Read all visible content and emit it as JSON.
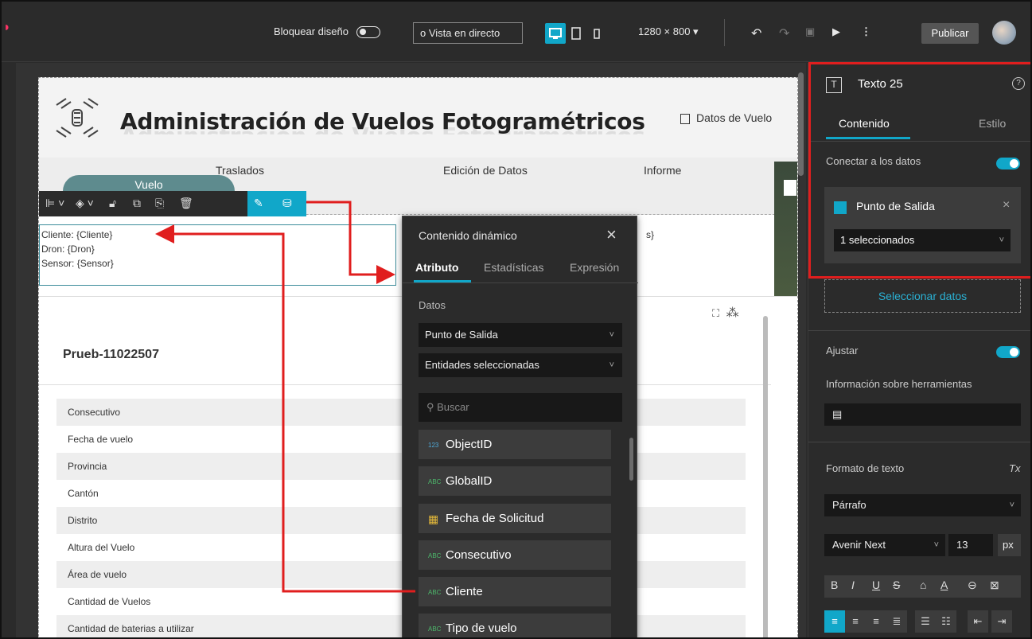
{
  "topbar": {
    "bloquear_label": "Bloquear diseño",
    "vista_label": "Vista en directo",
    "vista_icon": "circle-icon",
    "resolution": "1280 × 800",
    "publicar_label": "Publicar"
  },
  "page": {
    "title": "Administración de Vuelos Fotogramétricos",
    "title_shadow": "Administración de Vuelos Fotogramétricos",
    "datos_vuelo_link": "Datos de Vuelo",
    "nav": [
      "Vuelo",
      "Traslados",
      "Edición de Datos",
      "Informe"
    ]
  },
  "text_widget": {
    "lines": [
      "Cliente: {Cliente}",
      "Dron: {Dron}",
      "Sensor: {Sensor}"
    ],
    "partial_text": "s}"
  },
  "card": {
    "title": "Prueb-11022507",
    "rows": [
      "Consecutivo",
      "Fecha de vuelo",
      "Provincia",
      "Cantón",
      "Distrito",
      "Altura del Vuelo",
      "Área de vuelo",
      "Cantidad de Vuelos",
      "Cantidad de baterias a utilizar"
    ]
  },
  "popup": {
    "title": "Contenido dinámico",
    "tabs": [
      "Atributo",
      "Estadísticas",
      "Expresión"
    ],
    "datos_label": "Datos",
    "data_source": "Punto de Salida",
    "selection": "Entidades seleccionadas",
    "search_placeholder": "Buscar",
    "fields": [
      {
        "type": "123",
        "name": "ObjectID"
      },
      {
        "type": "ABC",
        "name": "GlobalID"
      },
      {
        "type": "date",
        "name": "Fecha de Solicitud"
      },
      {
        "type": "ABC",
        "name": "Consecutivo"
      },
      {
        "type": "ABC",
        "name": "Cliente"
      },
      {
        "type": "ABC",
        "name": "Tipo de vuelo"
      }
    ]
  },
  "rpanel": {
    "title": "Texto 25",
    "tabs": [
      "Contenido",
      "Estilo"
    ],
    "connect_label": "Conectar a los datos",
    "source_name": "Punto de Salida",
    "selection_value": "1 seleccionados",
    "select_data": "Seleccionar datos",
    "ajustar": "Ajustar",
    "tooltip_label": "Información sobre herramientas",
    "formato_label": "Formato de texto",
    "paragraph": "Párrafo",
    "font": "Avenir Next",
    "size": "13",
    "unit": "px"
  },
  "colors": {
    "accent": "#11a7c9",
    "highlight_red": "#e01e1e",
    "nav_pill": "#5e8b8e"
  }
}
